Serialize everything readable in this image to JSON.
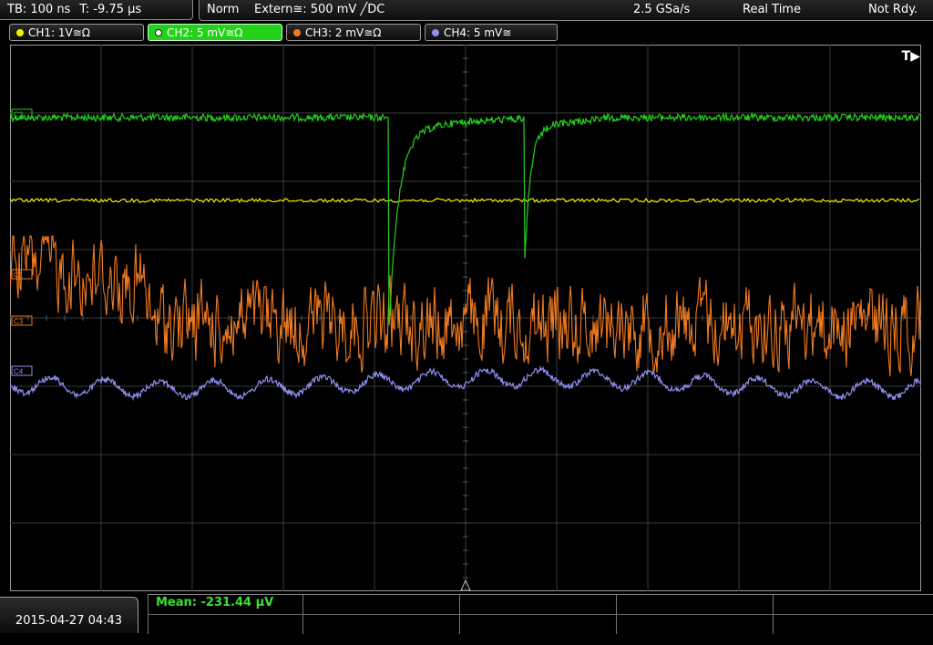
{
  "status": {
    "timebase": "TB: 100 ns",
    "trigger_time": "T: -9.75 µs",
    "mode": "Norm",
    "trigger_source": "Extern≅: 500 mV ╱DC",
    "sample_rate": "2.5 GSa/s",
    "acq_mode": "Real Time",
    "state": "Not Rdy."
  },
  "channels": [
    {
      "label": "CH1: 1V≅Ω",
      "color": "#f2f200",
      "active": false
    },
    {
      "label": "CH2: 5 mV≅Ω",
      "color": "#23d11b",
      "active": true
    },
    {
      "label": "CH3: 2 mV≅Ω",
      "color": "#f07a20",
      "active": false
    },
    {
      "label": "CH4: 5 mV≅",
      "color": "#8f8ff0",
      "active": false
    }
  ],
  "markers": {
    "c1": "C1",
    "c2": "C2",
    "c3": "C3",
    "c4": "C4",
    "trigger": "T▶"
  },
  "footer": {
    "datetime": "2015-04-27 04:43",
    "measurement": "Mean: -231.44 µV"
  },
  "colors": {
    "ch1": "#f2f200",
    "ch2": "#23d11b",
    "ch3": "#f07a20",
    "ch4": "#8f8ff0",
    "grid": "#3a3a3a"
  }
}
